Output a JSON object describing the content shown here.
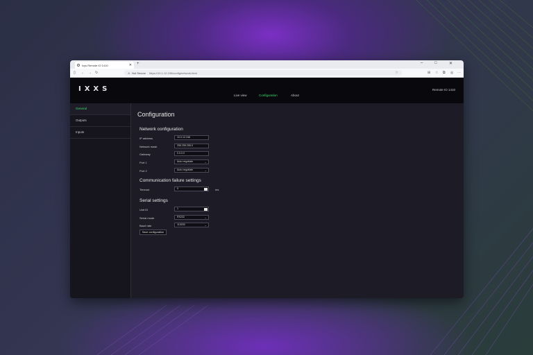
{
  "browser": {
    "tab_title": "Ixys Remote IO 1410",
    "url_secure_label": "Not Secure",
    "url": "https://10.1.12.245/config/network.html"
  },
  "app": {
    "logo": "IXXS",
    "nav": {
      "live_view": "Live view",
      "configuration": "Configuration",
      "about": "About"
    },
    "device_id": "Remote IO 1410"
  },
  "sidebar": {
    "items": [
      {
        "label": "General"
      },
      {
        "label": "Outputs"
      },
      {
        "label": "Inputs"
      }
    ]
  },
  "page": {
    "title": "Configuration"
  },
  "network": {
    "heading": "Network configuration",
    "ip_label": "IP address",
    "ip_value": "10.0.12.246",
    "mask_label": "Network mask",
    "mask_value": "255.255.255.0",
    "gateway_label": "Gateway",
    "gateway_value": "0.0.0.0",
    "port1_label": "Port 1",
    "port1_value": "Auto negotiate",
    "port2_label": "Port 2",
    "port2_value": "Auto negotiate"
  },
  "comm": {
    "heading": "Communication failure settings",
    "timeout_label": "Timeout",
    "timeout_value": "0",
    "timeout_unit": "ms"
  },
  "serial": {
    "heading": "Serial settings",
    "unit_label": "Unit ID",
    "unit_value": "1",
    "mode_label": "Serial mode",
    "mode_value": "RS232",
    "baud_label": "Baud rate",
    "baud_value": "115200"
  },
  "actions": {
    "save_label": "Save configuration"
  },
  "colors": {
    "accent": "#3ddb6a",
    "background": "#1c1b26"
  }
}
